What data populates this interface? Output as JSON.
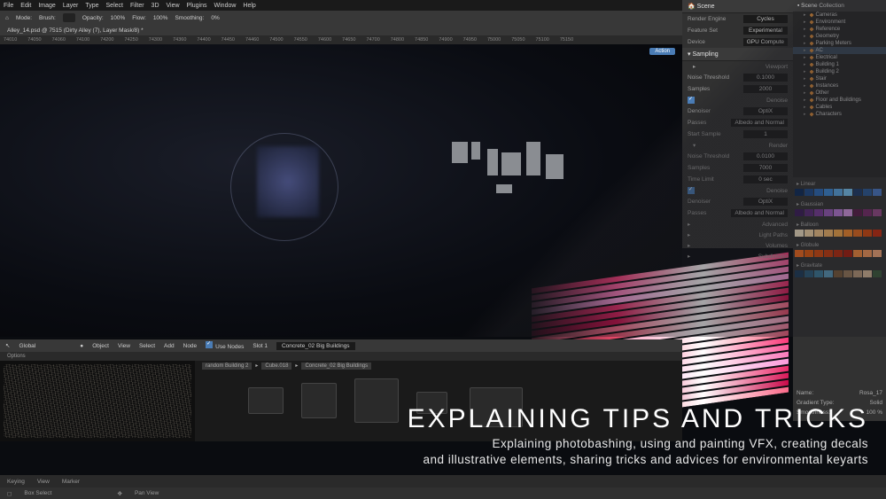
{
  "ps_menu": [
    "File",
    "Edit",
    "Image",
    "Layer",
    "Type",
    "Select",
    "Filter",
    "3D",
    "View",
    "Plugins",
    "Window",
    "Help"
  ],
  "ps_toolbar": {
    "mode": "Mode:",
    "brush": "Brush:",
    "opacity": "Opacity:",
    "opacity_val": "100%",
    "flow": "Flow:",
    "flow_val": "100%",
    "smoothing": "Smoothing:",
    "smoothing_val": "0%"
  },
  "ps_tab": "Alley_14.psd @ 7515 (Dirty Alley (7), Layer Mask/8) *",
  "timeline_marks": [
    "74010",
    "74050",
    "74060",
    "74100",
    "74200",
    "74250",
    "74300",
    "74360",
    "74400",
    "74450",
    "74460",
    "74500",
    "74550",
    "74600",
    "74650",
    "74700",
    "74800",
    "74850",
    "74900",
    "74950",
    "75000",
    "75050",
    "75100",
    "75150"
  ],
  "timeline_action": "Action",
  "scene": {
    "title": "Scene",
    "render_engine_label": "Render Engine",
    "render_engine": "Cycles",
    "feature_set_label": "Feature Set",
    "feature_set": "Experimental",
    "device_label": "Device",
    "device": "GPU Compute",
    "sampling": "Sampling",
    "viewport": "Viewport",
    "noise_threshold_label": "Noise Threshold",
    "noise_threshold": "0.1000",
    "samples_label": "Samples",
    "samples": "2000",
    "denoise": "Denoise",
    "denoiser_label": "Denoiser",
    "denoiser": "OptiX",
    "passes_label": "Passes",
    "passes": "Albedo and Normal",
    "start_sample_label": "Start Sample",
    "start_sample": "1",
    "render": "Render",
    "render_noise": "0.0100",
    "render_samples": "7000",
    "time_limit_label": "Time Limit",
    "time_limit": "0 sec",
    "advanced": "Advanced",
    "light_paths": "Light Paths",
    "volumes": "Volumes",
    "subdivision": "Subdivision"
  },
  "outliner": {
    "title": "Scene Collection",
    "items": [
      "Cameras",
      "Environment",
      "Reference",
      "Geometry",
      "Parking Meters",
      "AC",
      "Electrical",
      "Building 1",
      "Building 2",
      "Stair",
      "Instances",
      "Other",
      "Floor and Buildings",
      "Cables",
      "Characters"
    ]
  },
  "swatches": {
    "groups": [
      "Linear",
      "Gaussian",
      "Balloon",
      "Globule",
      "Gravitate"
    ]
  },
  "gradient": {
    "name_label": "Name:",
    "name": "Rosa_17",
    "type_label": "Gradient Type:",
    "type": "Solid",
    "smooth_label": "Smoothness:",
    "smooth": "100",
    "unit": "%"
  },
  "node_toolbar": {
    "global": "Global",
    "object": "Object",
    "view": "View",
    "select": "Select",
    "add": "Add",
    "node": "Node",
    "use_nodes": "Use Nodes",
    "slot": "Slot 1",
    "material": "Concrete_02 Big Buildings",
    "options": "Options"
  },
  "breadcrumb": [
    "random Building 2",
    "Cube.018",
    "Concrete_02 Big Buildings"
  ],
  "bottom": {
    "keying": "Keying",
    "view": "View",
    "marker": "Marker",
    "box": "Box Select",
    "pan": "Pan View"
  },
  "overlay": {
    "title": "EXPLAINING TIPS AND TRICKS",
    "sub1": "Explaining photobashing, using and painting VFX, creating decals",
    "sub2": "and illustrative elements, sharing tricks and advices for environmental keyarts"
  },
  "colors": {
    "blues": [
      "#0a2a5a",
      "#1a4a8a",
      "#2a6aba",
      "#3a8ada",
      "#5aaaea",
      "#7acafa",
      "#1a3a6a",
      "#2a5a9a",
      "#4a7aca"
    ],
    "purples": [
      "#3a1a5a",
      "#5a2a7a",
      "#7a3a9a",
      "#9a5aba",
      "#ba7ada",
      "#da9aea",
      "#5a1a4a",
      "#7a2a6a",
      "#9a4a8a"
    ],
    "warms": [
      "#faeaca",
      "#fadaaa",
      "#faca8a",
      "#faba6a",
      "#faaa4a",
      "#fa8a2a",
      "#ea6a1a",
      "#da4a0a",
      "#ca2a0a"
    ],
    "oranges": [
      "#fa6a1a",
      "#ea5a0a",
      "#da4a0a",
      "#ca3a0a",
      "#ba2a0a",
      "#aa1a0a",
      "#fa8a3a",
      "#fa9a5a",
      "#faaa7a"
    ],
    "mix": [
      "#1a3a5a",
      "#2a5a7a",
      "#3a7a9a",
      "#5a9aba",
      "#7a5a3a",
      "#9a7a5a",
      "#ba9a7a",
      "#daba9a",
      "#3a5a3a"
    ],
    "pinks": [
      "#fa3a7a",
      "#fa5a9a",
      "#fa7aba",
      "#fa9ada",
      "#ea2a6a",
      "#da1a5a",
      "#ca0a4a",
      "#fa6a8a",
      "#ea4a6a",
      "#faa0c0",
      "#f880a0",
      "#f66080"
    ]
  }
}
